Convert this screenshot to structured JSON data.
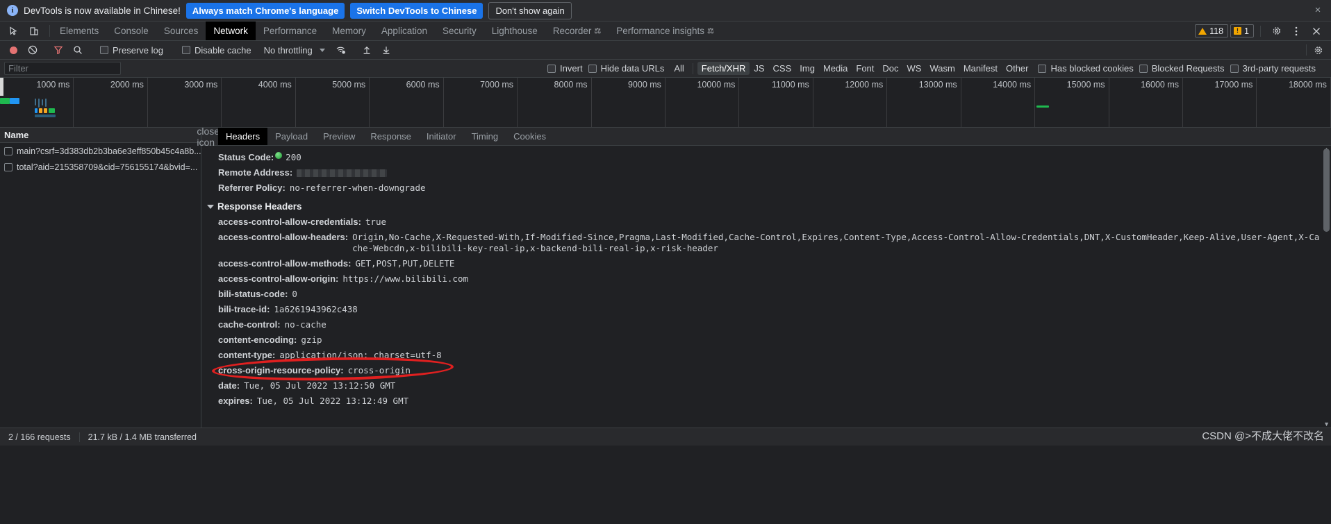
{
  "infobar": {
    "icon": "info-icon",
    "message": "DevTools is now available in Chinese!",
    "primary_button": "Always match Chrome's language",
    "secondary_button": "Switch DevTools to Chinese",
    "dismiss_button": "Don't show again",
    "close": "×"
  },
  "tabstrip": {
    "tabs": [
      {
        "label": "Elements",
        "active": false,
        "flask": false
      },
      {
        "label": "Console",
        "active": false,
        "flask": false
      },
      {
        "label": "Sources",
        "active": false,
        "flask": false
      },
      {
        "label": "Network",
        "active": true,
        "flask": false
      },
      {
        "label": "Performance",
        "active": false,
        "flask": false
      },
      {
        "label": "Memory",
        "active": false,
        "flask": false
      },
      {
        "label": "Application",
        "active": false,
        "flask": false
      },
      {
        "label": "Security",
        "active": false,
        "flask": false
      },
      {
        "label": "Lighthouse",
        "active": false,
        "flask": false
      },
      {
        "label": "Recorder",
        "active": false,
        "flask": true
      },
      {
        "label": "Performance insights",
        "active": false,
        "flask": true
      }
    ],
    "warning_count": "118",
    "error_count": "1",
    "error_glyph": "!",
    "settings_icon": "gear-icon",
    "more_icon": "kebab-menu-icon",
    "close_icon": "close-icon"
  },
  "network_toolbar": {
    "record_icon": "record-button",
    "clear_icon": "clear-icon",
    "filter_icon": "filter-icon",
    "search_icon": "search-icon",
    "preserve_log": "Preserve log",
    "disable_cache": "Disable cache",
    "throttling": "No throttling",
    "wifi_icon": "network-conditions-icon",
    "import_icon": "import-har-icon",
    "export_icon": "export-har-icon",
    "settings_icon": "gear-icon"
  },
  "filter_row": {
    "placeholder": "Filter",
    "value": "",
    "invert": "Invert",
    "hide_data_urls": "Hide data URLs",
    "types": [
      "All",
      "Fetch/XHR",
      "JS",
      "CSS",
      "Img",
      "Media",
      "Font",
      "Doc",
      "WS",
      "Wasm",
      "Manifest",
      "Other"
    ],
    "active_type": "Fetch/XHR",
    "has_blocked_cookies": "Has blocked cookies",
    "blocked_requests": "Blocked Requests",
    "third_party": "3rd-party requests"
  },
  "overview": {
    "ticks": [
      "1000 ms",
      "2000 ms",
      "3000 ms",
      "4000 ms",
      "5000 ms",
      "6000 ms",
      "7000 ms",
      "8000 ms",
      "9000 ms",
      "10000 ms",
      "11000 ms",
      "12000 ms",
      "13000 ms",
      "14000 ms",
      "15000 ms",
      "16000 ms",
      "17000 ms",
      "18000 ms"
    ]
  },
  "request_list": {
    "column_header": "Name",
    "rows": [
      {
        "name": "main?csrf=3d383db2b3ba6e3eff850b45c4a8b..."
      },
      {
        "name": "total?aid=215358709&cid=756155174&bvid=..."
      }
    ]
  },
  "detail": {
    "tabs": [
      {
        "label": "Headers",
        "active": true
      },
      {
        "label": "Payload",
        "active": false
      },
      {
        "label": "Preview",
        "active": false
      },
      {
        "label": "Response",
        "active": false
      },
      {
        "label": "Initiator",
        "active": false
      },
      {
        "label": "Timing",
        "active": false
      },
      {
        "label": "Cookies",
        "active": false
      }
    ],
    "close_icon": "close-icon",
    "general": [
      {
        "key": "Status Code:",
        "value": "200",
        "status_dot": true
      },
      {
        "key": "Remote Address:",
        "value": "",
        "redacted": true
      },
      {
        "key": "Referrer Policy:",
        "value": "no-referrer-when-downgrade"
      }
    ],
    "response_headers_title": "Response Headers",
    "response_headers": [
      {
        "key": "access-control-allow-credentials:",
        "value": "true"
      },
      {
        "key": "access-control-allow-headers:",
        "value": "Origin,No-Cache,X-Requested-With,If-Modified-Since,Pragma,Last-Modified,Cache-Control,Expires,Content-Type,Access-Control-Allow-Credentials,DNT,X-CustomHeader,Keep-Alive,User-Agent,X-Cache-Webcdn,x-bilibili-key-real-ip,x-backend-bili-real-ip,x-risk-header"
      },
      {
        "key": "access-control-allow-methods:",
        "value": "GET,POST,PUT,DELETE"
      },
      {
        "key": "access-control-allow-origin:",
        "value": "https://www.bilibili.com"
      },
      {
        "key": "bili-status-code:",
        "value": "0"
      },
      {
        "key": "bili-trace-id:",
        "value": "1a6261943962c438"
      },
      {
        "key": "cache-control:",
        "value": "no-cache"
      },
      {
        "key": "content-encoding:",
        "value": "gzip"
      },
      {
        "key": "content-type:",
        "value": "application/json; charset=utf-8",
        "highlighted": true
      },
      {
        "key": "cross-origin-resource-policy:",
        "value": "cross-origin"
      },
      {
        "key": "date:",
        "value": "Tue, 05 Jul 2022 13:12:50 GMT"
      },
      {
        "key": "expires:",
        "value": "Tue, 05 Jul 2022 13:12:49 GMT"
      }
    ]
  },
  "status_bar": {
    "requests": "2 / 166 requests",
    "transferred": "21.7 kB / 1.4 MB transferred"
  },
  "watermark": "CSDN @>不成大佬不改名",
  "colors": {
    "accent_blue": "#1a73e8",
    "warning": "#f2a600",
    "annotation_red": "#e02020",
    "status_green": "#1e9c34",
    "panel_bg": "#202124",
    "toolbar_bg": "#292a2d"
  }
}
